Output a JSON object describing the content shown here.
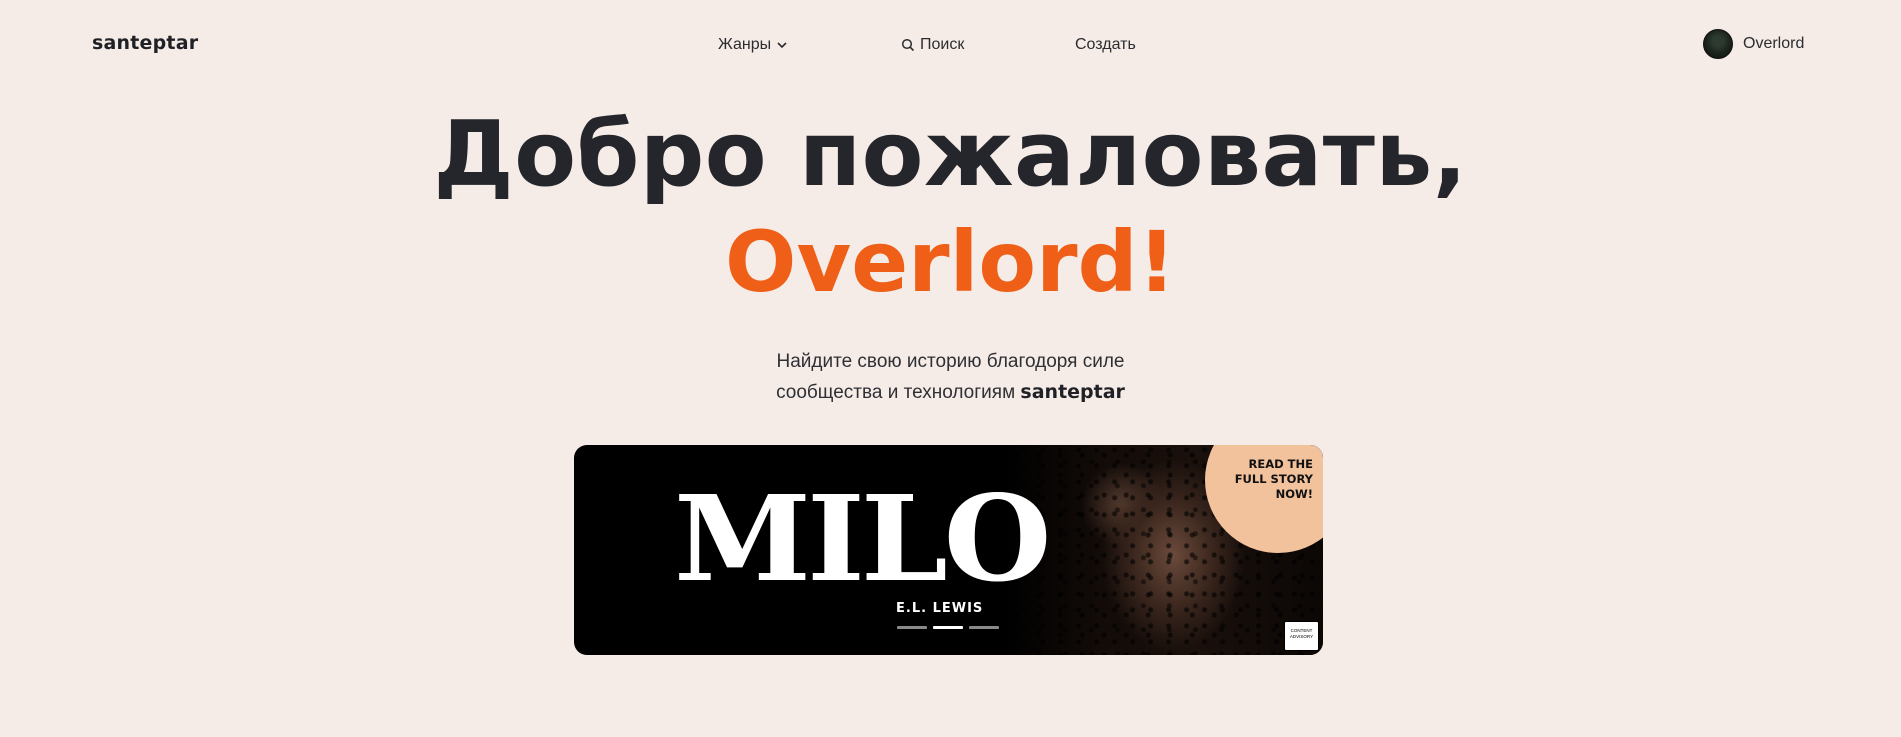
{
  "nav": {
    "logo": "santeptar",
    "genres_label": "Жанры",
    "search_label": "Поиск",
    "create_label": "Создать",
    "user_name": "Overlord"
  },
  "hero": {
    "line1": "Добро пожаловать,",
    "line2": "Overlord!",
    "tagline_line1": "Найдите свою историю благодоря силе",
    "tagline_line2_prefix": "сообщества и технологиям",
    "tagline_brand": "santeptar"
  },
  "banner": {
    "title": "MILO",
    "author": "E.L. LEWIS",
    "badge_line1": "READ THE",
    "badge_line2": "FULL STORY",
    "badge_line3": "NOW!",
    "advisory_line1": "CONTENT",
    "advisory_line2": "ADVISORY",
    "active_slide": 2,
    "slide_count": 3
  },
  "colors": {
    "background": "#f6ece7",
    "accent": "#ef5f17",
    "text": "#24262b",
    "badge": "#f2c29d"
  }
}
